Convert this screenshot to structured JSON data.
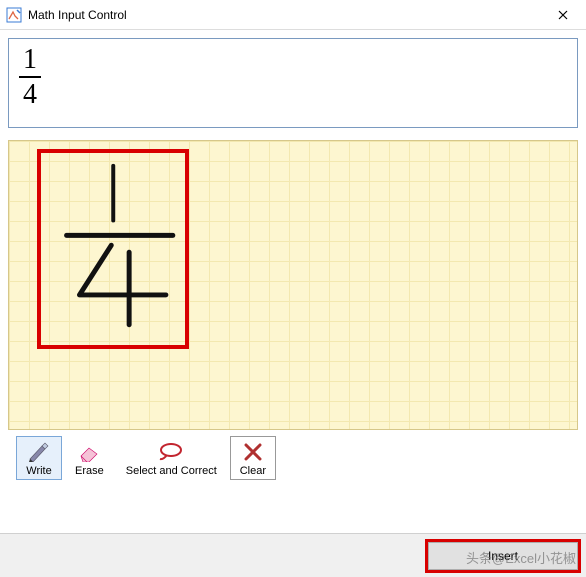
{
  "window": {
    "title": "Math Input Control",
    "close_label": "Close"
  },
  "preview": {
    "numerator": "1",
    "denominator": "4"
  },
  "ink": {
    "glyphs": {
      "one": "1",
      "four": "4"
    }
  },
  "toolbar": {
    "write": "Write",
    "erase": "Erase",
    "select_correct": "Select and Correct",
    "clear": "Clear"
  },
  "actions": {
    "insert": "Insert"
  },
  "watermark": "头条@Excel小花椒"
}
